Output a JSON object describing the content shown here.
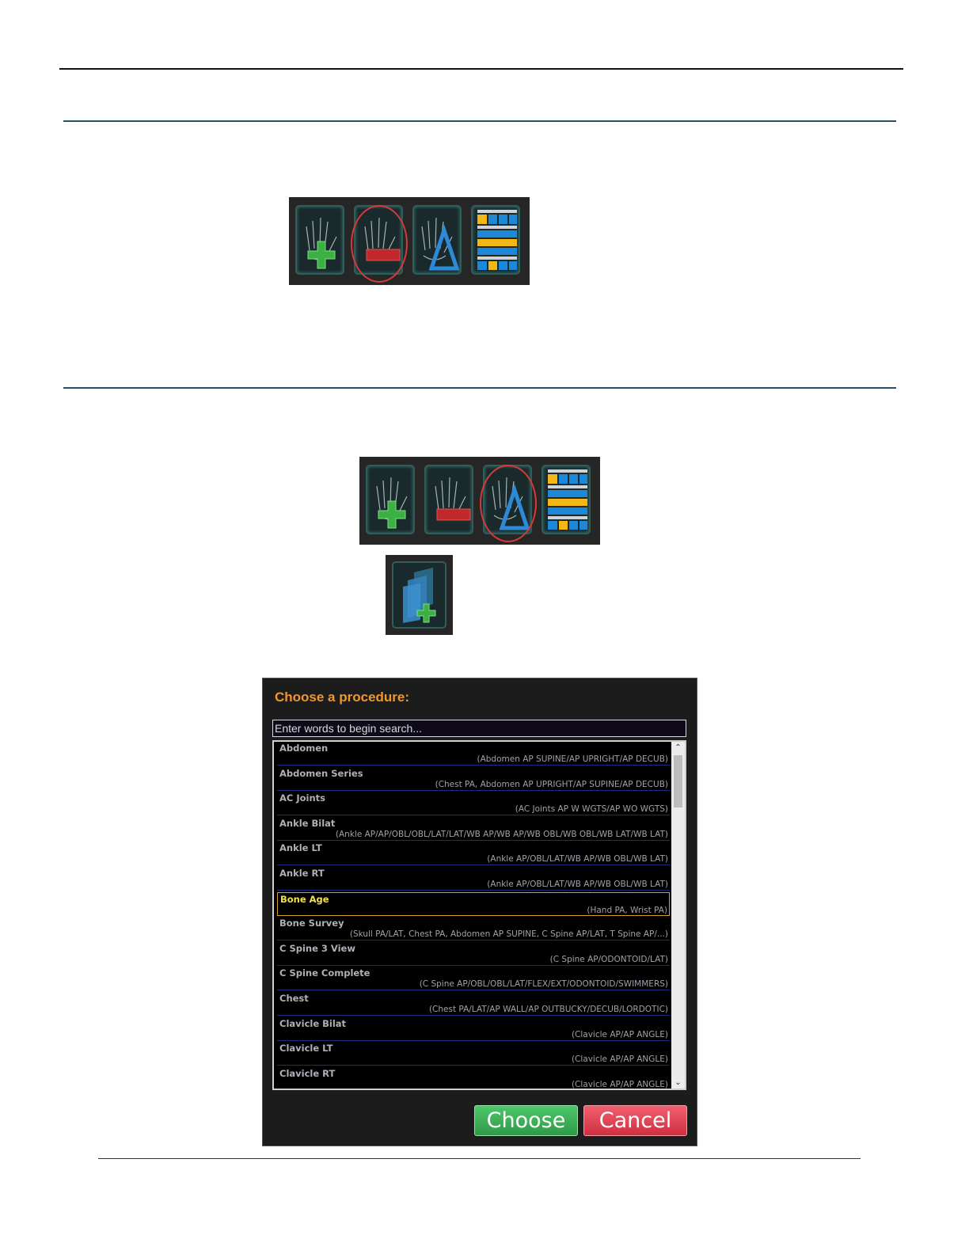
{
  "toolbar_icons": [
    "add-image-icon",
    "remove-image-icon",
    "edit-image-icon",
    "layout-icon"
  ],
  "dialog": {
    "title": "Choose a procedure:",
    "search_placeholder": "Enter words to begin search...",
    "items": [
      {
        "name": "Abdomen",
        "desc": "(Abdomen AP SUPINE/AP UPRIGHT/AP DECUB)",
        "selected": false
      },
      {
        "name": "Abdomen Series",
        "desc": "(Chest PA, Abdomen AP UPRIGHT/AP SUPINE/AP DECUB)",
        "selected": false
      },
      {
        "name": "AC Joints",
        "desc": "(AC Joints AP W WGTS/AP WO WGTS)",
        "selected": false
      },
      {
        "name": "Ankle Bilat",
        "desc": "(Ankle AP/AP/OBL/OBL/LAT/LAT/WB AP/WB AP/WB OBL/WB OBL/WB LAT/WB LAT)",
        "selected": false
      },
      {
        "name": "Ankle LT",
        "desc": "(Ankle AP/OBL/LAT/WB AP/WB OBL/WB LAT)",
        "selected": false
      },
      {
        "name": "Ankle RT",
        "desc": "(Ankle AP/OBL/LAT/WB AP/WB OBL/WB LAT)",
        "selected": false
      },
      {
        "name": "Bone Age",
        "desc": "(Hand PA, Wrist PA)",
        "selected": true
      },
      {
        "name": "Bone Survey",
        "desc": "(Skull PA/LAT, Chest PA, Abdomen AP SUPINE, C Spine AP/LAT, T Spine AP/...)",
        "selected": false
      },
      {
        "name": "C Spine 3 View",
        "desc": "(C Spine AP/ODONTOID/LAT)",
        "selected": false
      },
      {
        "name": "C Spine Complete",
        "desc": "(C Spine AP/OBL/OBL/LAT/FLEX/EXT/ODONTOID/SWIMMERS)",
        "selected": false
      },
      {
        "name": "Chest",
        "desc": "(Chest PA/LAT/AP WALL/AP OUTBUCKY/DECUB/LORDOTIC)",
        "selected": false
      },
      {
        "name": "Clavicle Bilat",
        "desc": "(Clavicle AP/AP ANGLE)",
        "selected": false
      },
      {
        "name": "Clavicle LT",
        "desc": "(Clavicle AP/AP ANGLE)",
        "selected": false
      },
      {
        "name": "Clavicle RT",
        "desc": "(Clavicle AP/AP ANGLE)",
        "selected": false
      }
    ],
    "choose_label": "Choose",
    "cancel_label": "Cancel"
  },
  "colors": {
    "title_orange": "#f0962a",
    "selected_yellow": "#f4e04a",
    "choose_green": "#3fb058",
    "cancel_red": "#e04050"
  }
}
